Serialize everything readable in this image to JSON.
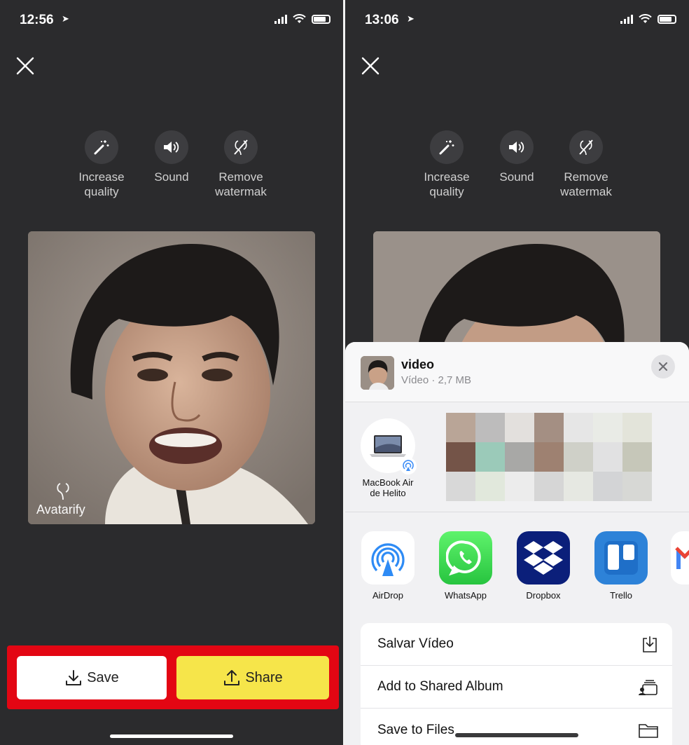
{
  "left": {
    "status": {
      "time": "12:56",
      "signal": "signal-icon",
      "wifi": "wifi-icon",
      "battery": "battery-icon"
    },
    "tools": [
      {
        "line1": "Increase",
        "line2": "quality",
        "icon": "magic-wand-icon"
      },
      {
        "line1": "Sound",
        "line2": "",
        "icon": "speaker-icon"
      },
      {
        "line1": "Remove",
        "line2": "watermak",
        "icon": "no-watermark-icon"
      }
    ],
    "watermark": "Avatarify",
    "buttons": {
      "save": "Save",
      "share": "Share"
    },
    "highlight_color": "#e30613",
    "share_color": "#f6e54a"
  },
  "right": {
    "status": {
      "time": "13:06"
    },
    "tools": [
      {
        "line1": "Increase",
        "line2": "quality"
      },
      {
        "line1": "Sound",
        "line2": ""
      },
      {
        "line1": "Remove",
        "line2": "watermak"
      }
    ],
    "sheet": {
      "file_name": "video",
      "file_meta": "Vídeo · 2,7 MB",
      "contact": {
        "line1": "MacBook Air",
        "line2": "de Helito"
      },
      "apps": [
        {
          "label": "AirDrop",
          "icon": "airdrop-icon"
        },
        {
          "label": "WhatsApp",
          "icon": "whatsapp-icon"
        },
        {
          "label": "Dropbox",
          "icon": "dropbox-icon"
        },
        {
          "label": "Trello",
          "icon": "trello-icon"
        }
      ],
      "actions": [
        {
          "label": "Salvar Vídeo",
          "icon": "save-to-device-icon"
        },
        {
          "label": "Add to Shared Album",
          "icon": "shared-album-icon"
        },
        {
          "label": "Save to Files",
          "icon": "folder-icon"
        }
      ]
    }
  }
}
